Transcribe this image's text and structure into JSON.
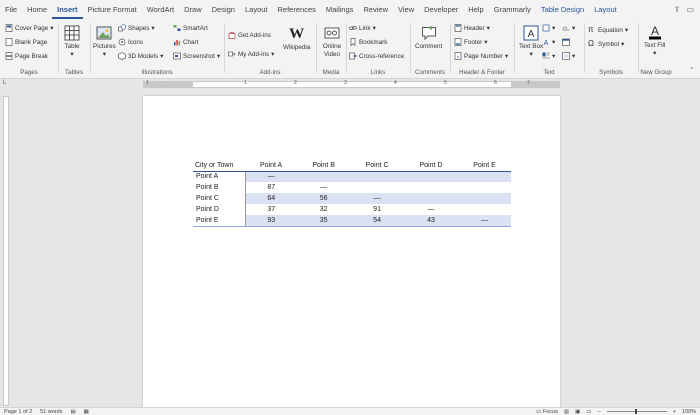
{
  "tabs": [
    {
      "label": "File",
      "state": ""
    },
    {
      "label": "Home",
      "state": ""
    },
    {
      "label": "Insert",
      "state": "active"
    },
    {
      "label": "Picture Format",
      "state": ""
    },
    {
      "label": "WordArt",
      "state": ""
    },
    {
      "label": "Draw",
      "state": ""
    },
    {
      "label": "Design",
      "state": ""
    },
    {
      "label": "Layout",
      "state": ""
    },
    {
      "label": "References",
      "state": ""
    },
    {
      "label": "Mailings",
      "state": ""
    },
    {
      "label": "Review",
      "state": ""
    },
    {
      "label": "View",
      "state": ""
    },
    {
      "label": "Developer",
      "state": ""
    },
    {
      "label": "Help",
      "state": ""
    },
    {
      "label": "Grammarly",
      "state": ""
    },
    {
      "label": "Table Design",
      "state": "ctx"
    },
    {
      "label": "Layout",
      "state": "ctx"
    }
  ],
  "ribbon": {
    "pages": {
      "label": "Pages",
      "cover_page": "Cover Page",
      "blank_page": "Blank Page",
      "page_break": "Page Break"
    },
    "tables": {
      "label": "Tables",
      "table": "Table"
    },
    "illustrations": {
      "label": "Illustrations",
      "pictures": "Pictures",
      "shapes": "Shapes",
      "icons": "Icons",
      "models": "3D Models",
      "smartart": "SmartArt",
      "chart": "Chart",
      "screenshot": "Screenshot"
    },
    "addins": {
      "label": "Add-ins",
      "get": "Get Add-ins",
      "my": "My Add-ins",
      "wikipedia": "Wikipedia"
    },
    "media": {
      "label": "Media",
      "online_video": "Online Video"
    },
    "links": {
      "label": "Links",
      "link": "Link",
      "bookmark": "Bookmark",
      "cross_ref": "Cross-reference"
    },
    "comments": {
      "label": "Comments",
      "comment": "Comment"
    },
    "header_footer": {
      "label": "Header & Footer",
      "header": "Header",
      "footer": "Footer",
      "page_number": "Page Number"
    },
    "text": {
      "label": "Text",
      "text_box": "Text Box"
    },
    "symbols": {
      "label": "Symbols",
      "equation": "Equation",
      "symbol": "Symbol"
    },
    "new_group": {
      "label": "New Group",
      "text_fill": "Text Fill"
    }
  },
  "table": {
    "headers": [
      "City or Town",
      "Point A",
      "Point B",
      "Point C",
      "Point D",
      "Point E"
    ],
    "rows": [
      [
        "Point A",
        "—",
        "",
        "",
        "",
        ""
      ],
      [
        "Point B",
        "87",
        "—",
        "",
        "",
        ""
      ],
      [
        "Point C",
        "64",
        "56",
        "—",
        "",
        ""
      ],
      [
        "Point D",
        "37",
        "32",
        "91",
        "—",
        ""
      ],
      [
        "Point E",
        "93",
        "35",
        "54",
        "43",
        "—"
      ]
    ]
  },
  "status": {
    "page": "Page 1 of 2",
    "words": "51 words",
    "focus": "Focus",
    "zoom": "100%"
  },
  "colors": {
    "accent": "#2b579a",
    "table_border": "#2f5597",
    "band": "#d9e1f2"
  }
}
